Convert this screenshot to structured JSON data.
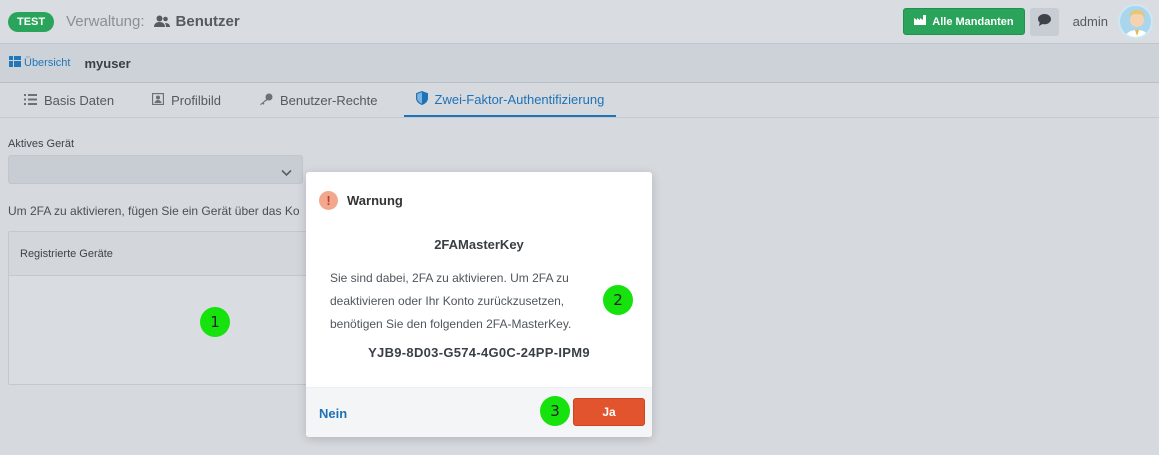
{
  "header": {
    "env_badge": "TEST",
    "app_title": "Verwaltung:",
    "page_name": "Benutzer",
    "mandanten_button": "Alle Mandanten",
    "user_name": "admin"
  },
  "breadcrumb": {
    "overview_label": "Übersicht",
    "current": "myuser"
  },
  "tabs": [
    {
      "label": "Basis Daten",
      "icon": "list-icon"
    },
    {
      "label": "Profilbild",
      "icon": "image-icon"
    },
    {
      "label": "Benutzer-Rechte",
      "icon": "key-icon"
    },
    {
      "label": "Zwei-Faktor-Authentifizierung",
      "icon": "shield-icon",
      "active": true
    }
  ],
  "content": {
    "device_label": "Aktives Gerät",
    "device_value": "",
    "hint": "Um 2FA zu aktivieren, fügen Sie ein Gerät über das Ko",
    "devices_header": "Registrierte Geräte"
  },
  "modal": {
    "title": "Warnung",
    "key_title": "2FAMasterKey",
    "text": "Sie sind dabei, 2FA zu aktivieren. Um 2FA zu deaktivieren oder Ihr Konto zurückzusetzen, benötigen Sie den folgenden 2FA-MasterKey.",
    "master_key": "YJB9-8D03-G574-4G0C-24PP-IPM9",
    "no_label": "Nein",
    "yes_label": "Ja"
  },
  "markers": [
    "1",
    "2",
    "3"
  ],
  "colors": {
    "primary_green": "#2aa45a",
    "link_blue": "#1e72b6",
    "danger_orange": "#e2542d",
    "marker_green": "#16e20e"
  }
}
